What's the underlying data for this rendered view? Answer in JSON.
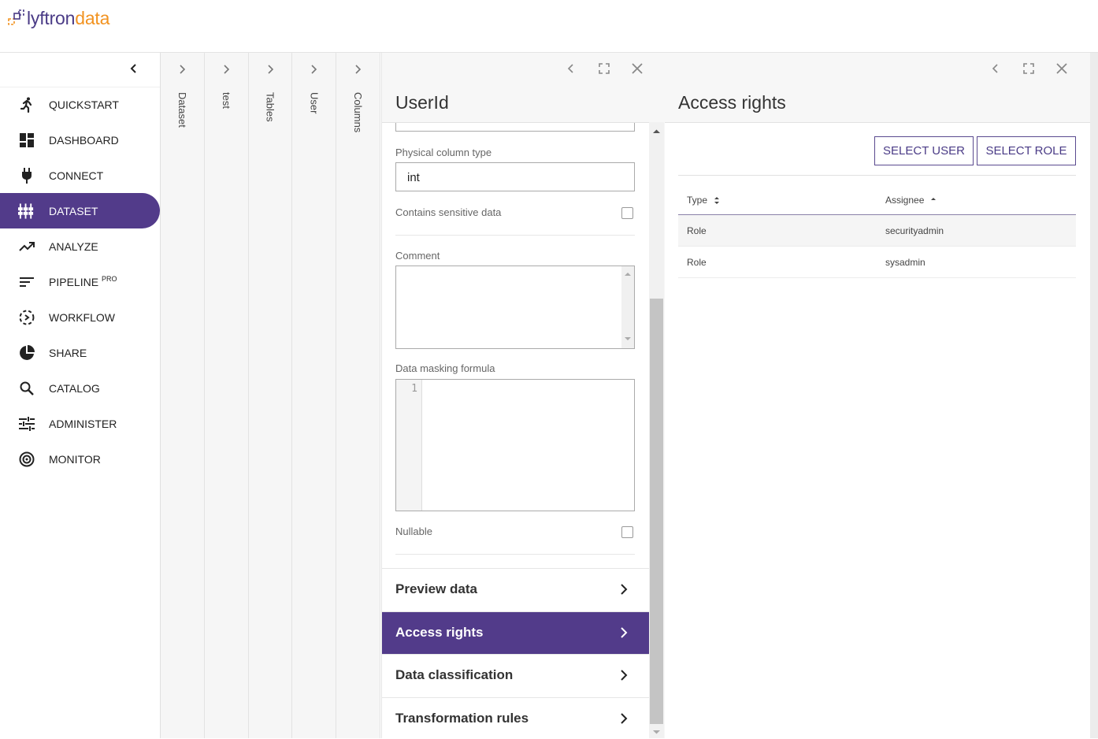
{
  "brand": {
    "part1": "lyftron",
    "part2": "data"
  },
  "sidebar": {
    "items": [
      {
        "label": "QUICKSTART",
        "icon": "running-person-icon"
      },
      {
        "label": "DASHBOARD",
        "icon": "dashboard-icon"
      },
      {
        "label": "CONNECT",
        "icon": "plug-icon"
      },
      {
        "label": "DATASET",
        "icon": "dataset-icon",
        "active": true
      },
      {
        "label": "ANALYZE",
        "icon": "trending-up-icon"
      },
      {
        "label": "PIPELINE",
        "sup": "PRO",
        "icon": "pipeline-icon"
      },
      {
        "label": "WORKFLOW",
        "icon": "workflow-icon"
      },
      {
        "label": "SHARE",
        "icon": "pie-chart-icon"
      },
      {
        "label": "CATALOG",
        "icon": "search-icon"
      },
      {
        "label": "ADMINISTER",
        "icon": "sliders-icon"
      },
      {
        "label": "MONITOR",
        "icon": "target-icon"
      }
    ]
  },
  "breadcrumbs": [
    "Dataset",
    "test",
    "Tables",
    "User",
    "Columns"
  ],
  "column_panel": {
    "title": "UserId",
    "physical_type_label": "Physical column type",
    "physical_type_value": "int",
    "sensitive_label": "Contains sensitive data",
    "sensitive_checked": false,
    "comment_label": "Comment",
    "comment_value": "",
    "masking_label": "Data masking formula",
    "masking_line": "1",
    "nullable_label": "Nullable",
    "nullable_checked": false,
    "sections": [
      {
        "label": "Preview data",
        "active": false
      },
      {
        "label": "Access rights",
        "active": true
      },
      {
        "label": "Data classification",
        "active": false
      },
      {
        "label": "Transformation rules",
        "active": false
      }
    ]
  },
  "access_panel": {
    "title": "Access rights",
    "select_user": "SELECT USER",
    "select_role": "SELECT ROLE",
    "columns": [
      "Type",
      "Assignee"
    ],
    "rows": [
      {
        "type": "Role",
        "assignee": "securityadmin"
      },
      {
        "type": "Role",
        "assignee": "sysadmin"
      }
    ]
  },
  "colors": {
    "accent": "#523b8a",
    "brand_orange": "#f29321",
    "brand_purple": "#4a3b86"
  }
}
